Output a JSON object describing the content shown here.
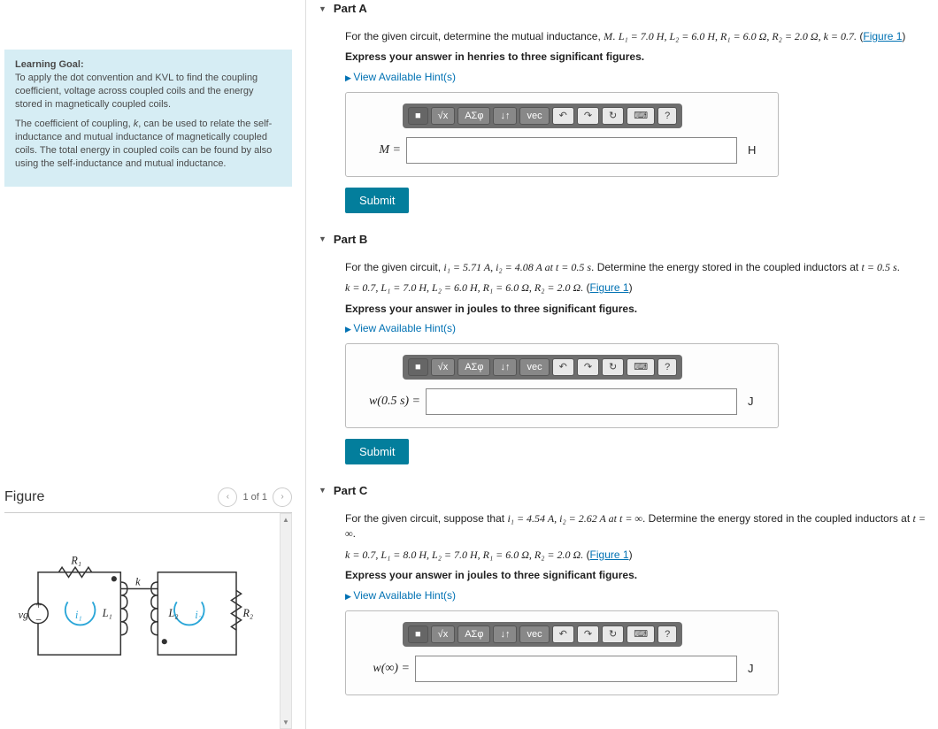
{
  "learning_goal": {
    "heading": "Learning Goal:",
    "para1": "To apply the dot convention and KVL to find the coupling coefficient, voltage across coupled coils and the energy stored in magnetically coupled coils.",
    "para2_a": "The coefficient of coupling, ",
    "para2_k": "k",
    "para2_b": ", can be used to relate the self-inductance and mutual inductance of magnetically coupled coils. The total energy in coupled coils can be found by also using the self-inductance and mutual inductance."
  },
  "figure": {
    "title": "Figure",
    "counter": "1 of 1",
    "labels": {
      "R1": "R₁",
      "R2": "R₂",
      "L1": "L₁",
      "L2": "L₂",
      "i1": "i₁",
      "i2": "i₂",
      "k": "k",
      "vg": "vg",
      "plus": "+",
      "minus": "−"
    }
  },
  "partA": {
    "title": "Part A",
    "q_a": "For the given circuit, determine the mutual inductance, ",
    "q_M": "M",
    "q_b": ". ",
    "params": "L₁ = 7.0 H, L₂ = 6.0 H, R₁ = 6.0 Ω, R₂ = 2.0 Ω, k = 0.7.",
    "figref": "Figure 1",
    "instr": "Express your answer in henries to three significant figures.",
    "hint": "View Available Hint(s)",
    "var": "M =",
    "unit": "H",
    "submit": "Submit"
  },
  "partB": {
    "title": "Part B",
    "q_a": "For the given circuit, ",
    "q_vals": "i₁ = 5.71 A, i₂ = 4.08 A at t = 0.5 s",
    "q_b": ". Determine the energy stored in the coupled inductors at ",
    "q_t": "t = 0.5 s",
    "q_c": ".",
    "params": "k = 0.7, L₁ = 7.0 H, L₂ = 6.0 H, R₁ = 6.0 Ω, R₂ = 2.0 Ω.",
    "figref": "Figure 1",
    "instr": "Express your answer in joules to three significant figures.",
    "hint": "View Available Hint(s)",
    "var": "w(0.5 s) =",
    "unit": "J",
    "submit": "Submit"
  },
  "partC": {
    "title": "Part C",
    "q_a": "For the given circuit, suppose that ",
    "q_vals": "i₁ = 4.54 A, i₂ = 2.62 A at t = ∞",
    "q_b": ". Determine the energy stored in the coupled inductors at ",
    "q_t": "t = ∞",
    "q_c": ".",
    "params": "k = 0.7, L₁ = 8.0 H, L₂ = 7.0 H, R₁ = 6.0 Ω, R₂ = 2.0 Ω.",
    "figref": "Figure 1",
    "instr": "Express your answer in joules to three significant figures.",
    "hint": "View Available Hint(s)",
    "var": "w(∞) =",
    "unit": "J"
  },
  "toolbar": {
    "b1": "■",
    "b2": "√x",
    "b3": "ΑΣφ",
    "b4": "↓↑",
    "b5": "vec",
    "b6": "↶",
    "b7": "↷",
    "b8": "↻",
    "b9": "⌨",
    "b10": "?"
  }
}
